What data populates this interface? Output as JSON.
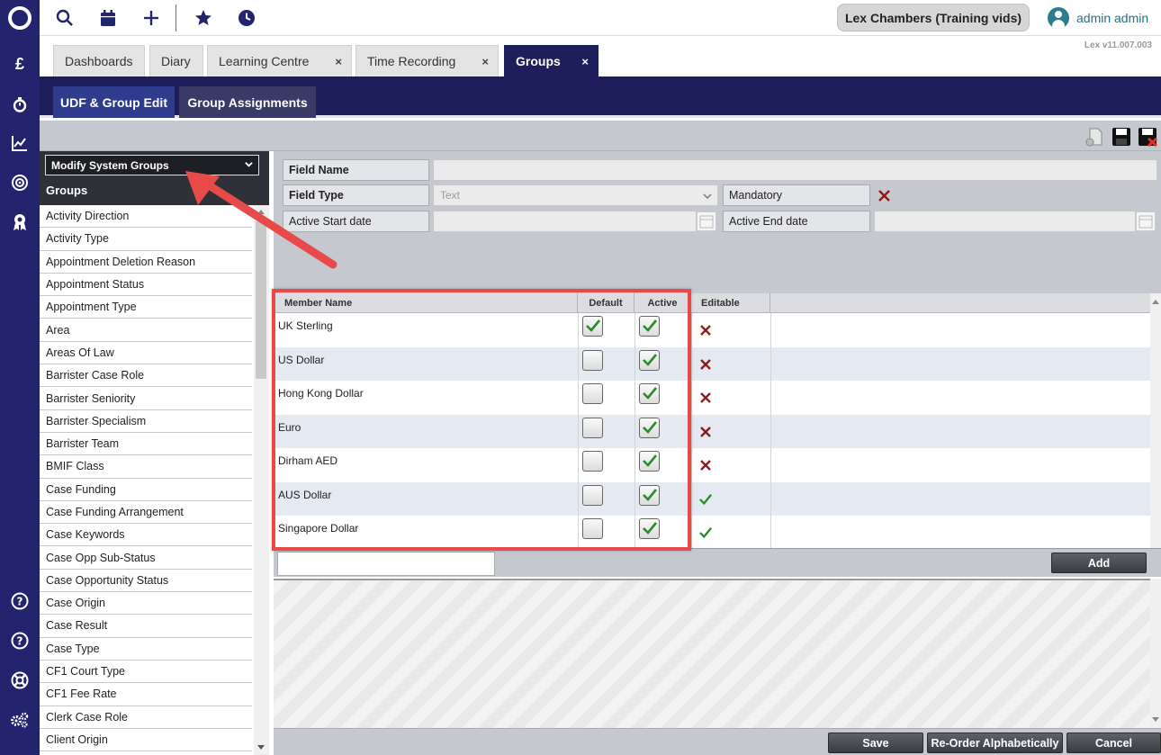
{
  "topbar": {
    "chambers_label": "Lex Chambers (Training vids)",
    "user_name": "admin admin",
    "version": "Lex v11.007.003"
  },
  "tabs": [
    {
      "label": "Dashboards",
      "closable": false
    },
    {
      "label": "Diary",
      "closable": false
    },
    {
      "label": "Learning Centre",
      "closable": true
    },
    {
      "label": "Time Recording",
      "closable": true
    },
    {
      "label": "Groups",
      "closable": true,
      "active": true
    }
  ],
  "close_glyph": "×",
  "subtabs": [
    "UDF & Group Edit",
    "Group Assignments"
  ],
  "groups_panel": {
    "selected": "Modify System Groups",
    "title": "Groups",
    "items": [
      "Activity Direction",
      "Activity Type",
      "Appointment Deletion Reason",
      "Appointment Status",
      "Appointment Type",
      "Area",
      "Areas Of Law",
      "Barrister Case Role",
      "Barrister Seniority",
      "Barrister Specialism",
      "Barrister Team",
      "BMIF Class",
      "Case Funding",
      "Case Funding Arrangement",
      "Case Keywords",
      "Case Opp Sub-Status",
      "Case Opportunity Status",
      "Case Origin",
      "Case Result",
      "Case Type",
      "CF1 Court Type",
      "CF1 Fee Rate",
      "Clerk Case Role",
      "Client Origin"
    ]
  },
  "form": {
    "field_name_label": "Field Name",
    "field_type_label": "Field Type",
    "field_type_value": "Text",
    "mandatory_label": "Mandatory",
    "active_start_label": "Active Start date",
    "active_end_label": "Active End date"
  },
  "grid": {
    "headers": {
      "member": "Member Name",
      "default": "Default",
      "active": "Active",
      "editable": "Editable"
    },
    "rows": [
      {
        "name": "UK Sterling",
        "default": true,
        "active": true,
        "editable": false
      },
      {
        "name": "US Dollar",
        "default": false,
        "active": true,
        "editable": false
      },
      {
        "name": "Hong Kong Dollar",
        "default": false,
        "active": true,
        "editable": false
      },
      {
        "name": "Euro",
        "default": false,
        "active": true,
        "editable": false
      },
      {
        "name": "Dirham AED",
        "default": false,
        "active": true,
        "editable": false
      },
      {
        "name": "AUS Dollar",
        "default": false,
        "active": true,
        "editable": true
      },
      {
        "name": "Singapore Dollar",
        "default": false,
        "active": true,
        "editable": true
      }
    ],
    "add_label": "Add"
  },
  "footer": {
    "save": "Save",
    "reorder": "Re-Order Alphabetically",
    "cancel": "Cancel"
  },
  "colors": {
    "rail": "#23236e",
    "band": "#1e1e5a",
    "highlight": "#e84a4a",
    "check": "#2a8a2a",
    "cross": "#8b1a1a"
  }
}
